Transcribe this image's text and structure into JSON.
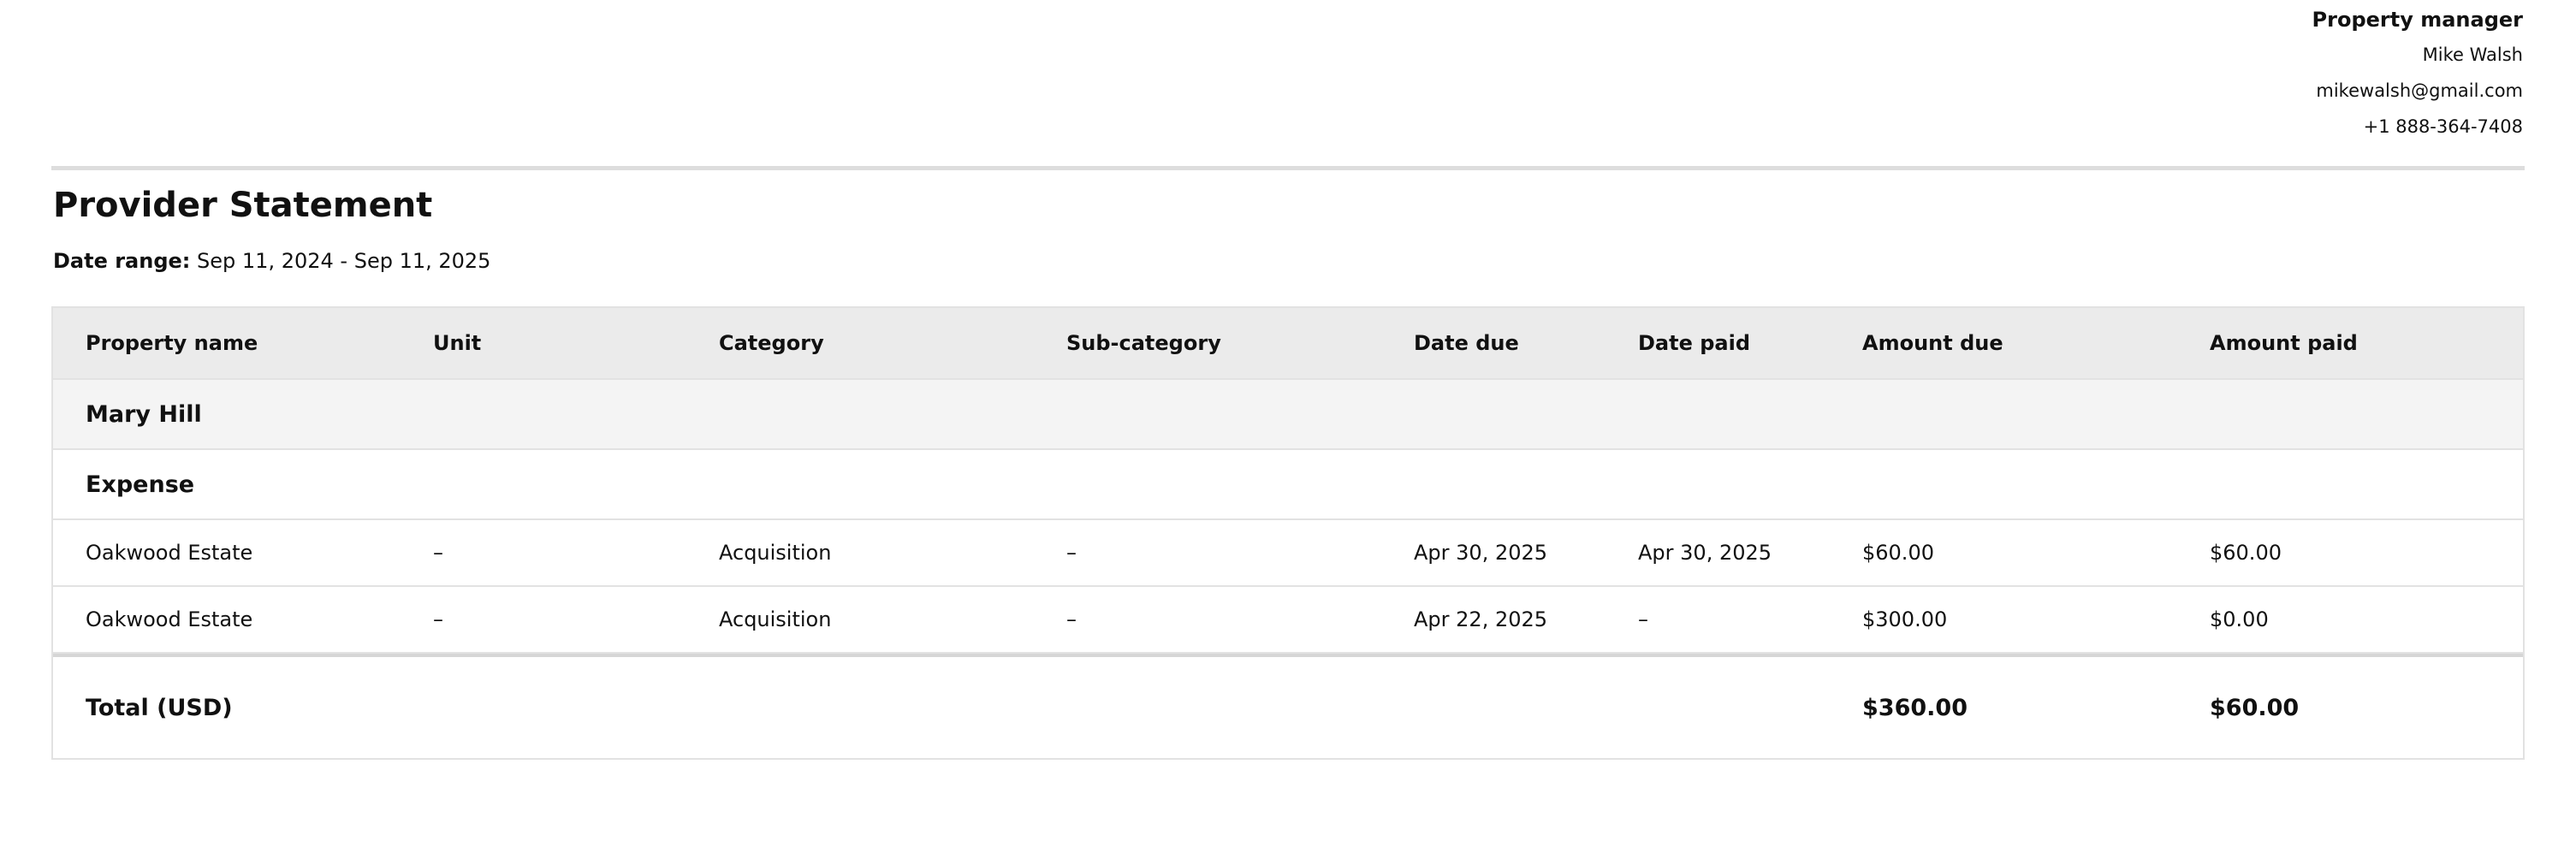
{
  "manager": {
    "role": "Property manager",
    "name": "Mike Walsh",
    "email": "mikewalsh@gmail.com",
    "phone": "+1 888-364-7408"
  },
  "statement": {
    "title": "Provider Statement",
    "date_range_label": "Date range:",
    "date_range_value": "Sep 11, 2024 - Sep 11, 2025"
  },
  "table": {
    "columns": [
      "Property name",
      "Unit",
      "Category",
      "Sub-category",
      "Date due",
      "Date paid",
      "Amount due",
      "Amount paid"
    ],
    "group": "Mary Hill",
    "section": "Expense",
    "rows": [
      [
        "Oakwood Estate",
        "–",
        "Acquisition",
        "–",
        "Apr 30, 2025",
        "Apr 30, 2025",
        "$60.00",
        "$60.00"
      ],
      [
        "Oakwood Estate",
        "–",
        "Acquisition",
        "–",
        "Apr 22, 2025",
        "–",
        "$300.00",
        "$0.00"
      ]
    ],
    "total": {
      "label": "Total (USD)",
      "amount_due": "$360.00",
      "amount_paid": "$60.00"
    }
  }
}
